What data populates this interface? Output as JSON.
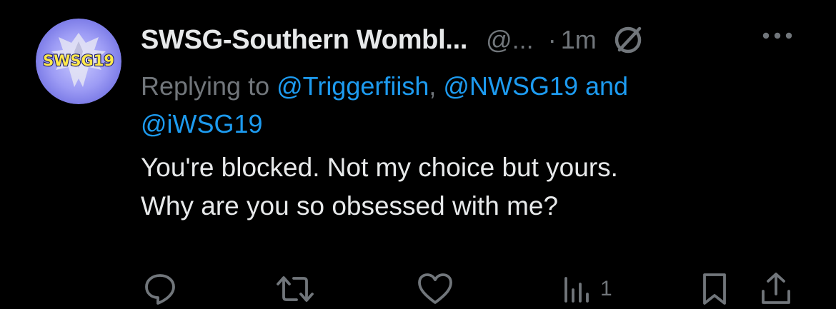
{
  "tweet": {
    "avatar": {
      "text": "SWSG19",
      "bg_color": "#7d7df0",
      "text_color": "#ffe94a"
    },
    "author": {
      "display_name": "SWSG-Southern Wombl...",
      "handle": "@...",
      "separator": "·",
      "time": "1m"
    },
    "reply": {
      "prefix": "Replying to",
      "mention1": "@Triggerfiish",
      "comma": ",",
      "mention2": "@NWSG19",
      "conjunction": "and",
      "mention3": "@iWSG19"
    },
    "text_lines": [
      "You're blocked. Not my choice but yours.",
      "Why are you so obsessed with me?"
    ],
    "actions": {
      "views_count": "1"
    },
    "icons": {
      "header": [
        "blocked-icon",
        "more-icon"
      ],
      "actions": [
        "reply-icon",
        "retweet-icon",
        "like-icon",
        "views-icon",
        "bookmark-icon",
        "share-icon"
      ]
    },
    "colors": {
      "background": "#000000",
      "text": "#e7e9ea",
      "secondary": "#71767b",
      "link": "#1d9bf0"
    }
  }
}
